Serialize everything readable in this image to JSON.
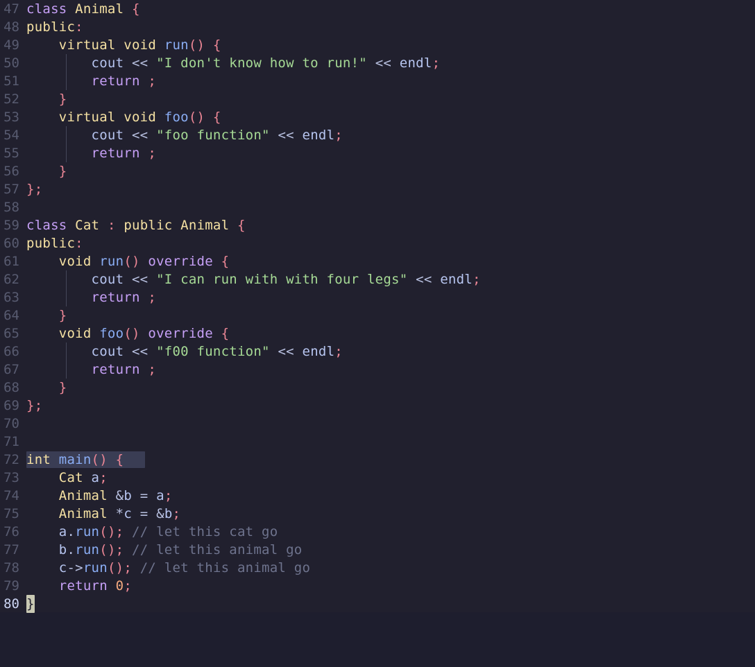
{
  "editor": {
    "theme_name": "catppuccin-macchiato",
    "background": "#21202e",
    "gutter_color": "#585b70",
    "current_line_number_color": "#cdd6f4",
    "cursor_color": "#c9c9b4",
    "bracket_match_highlight": "#3a3d54",
    "indent_guide_color": "#45475a",
    "language": "cpp",
    "first_visible_line": 47,
    "last_visible_line": 80,
    "cursor_line": 80,
    "cursor_column": 1,
    "cursor_char": "}"
  },
  "palette": {
    "keyword": "#c6a0f6",
    "type": "#f5e1a3",
    "function": "#8aadf4",
    "punctuation": "#ed8796",
    "string": "#a6da95",
    "operator": "#b8c0e0",
    "variable": "#b7c5f0",
    "number": "#f5a97f",
    "comment": "#6e738d"
  },
  "lines": [
    {
      "n": "47",
      "text": "class Animal {"
    },
    {
      "n": "48",
      "text": "public:"
    },
    {
      "n": "49",
      "text": "    virtual void run() {"
    },
    {
      "n": "50",
      "text": "        cout << \"I don't know how to run!\" << endl;"
    },
    {
      "n": "51",
      "text": "        return ;"
    },
    {
      "n": "52",
      "text": "    }"
    },
    {
      "n": "53",
      "text": "    virtual void foo() {"
    },
    {
      "n": "54",
      "text": "        cout << \"foo function\" << endl;"
    },
    {
      "n": "55",
      "text": "        return ;"
    },
    {
      "n": "56",
      "text": "    }"
    },
    {
      "n": "57",
      "text": "};"
    },
    {
      "n": "58",
      "text": ""
    },
    {
      "n": "59",
      "text": "class Cat : public Animal {"
    },
    {
      "n": "60",
      "text": "public:"
    },
    {
      "n": "61",
      "text": "    void run() override {"
    },
    {
      "n": "62",
      "text": "        cout << \"I can run with with four legs\" << endl;"
    },
    {
      "n": "63",
      "text": "        return ;"
    },
    {
      "n": "64",
      "text": "    }"
    },
    {
      "n": "65",
      "text": "    void foo() override {"
    },
    {
      "n": "66",
      "text": "        cout << \"f00 function\" << endl;"
    },
    {
      "n": "67",
      "text": "        return ;"
    },
    {
      "n": "68",
      "text": "    }"
    },
    {
      "n": "69",
      "text": "};"
    },
    {
      "n": "70",
      "text": ""
    },
    {
      "n": "71",
      "text": ""
    },
    {
      "n": "72",
      "text": "int main() {"
    },
    {
      "n": "73",
      "text": "    Cat a;"
    },
    {
      "n": "74",
      "text": "    Animal &b = a;"
    },
    {
      "n": "75",
      "text": "    Animal *c = &b;"
    },
    {
      "n": "76",
      "text": "    a.run(); // let this cat go"
    },
    {
      "n": "77",
      "text": "    b.run(); // let this animal go"
    },
    {
      "n": "78",
      "text": "    c->run(); // let this animal go"
    },
    {
      "n": "79",
      "text": "    return 0;"
    },
    {
      "n": "80",
      "text": "}"
    }
  ]
}
